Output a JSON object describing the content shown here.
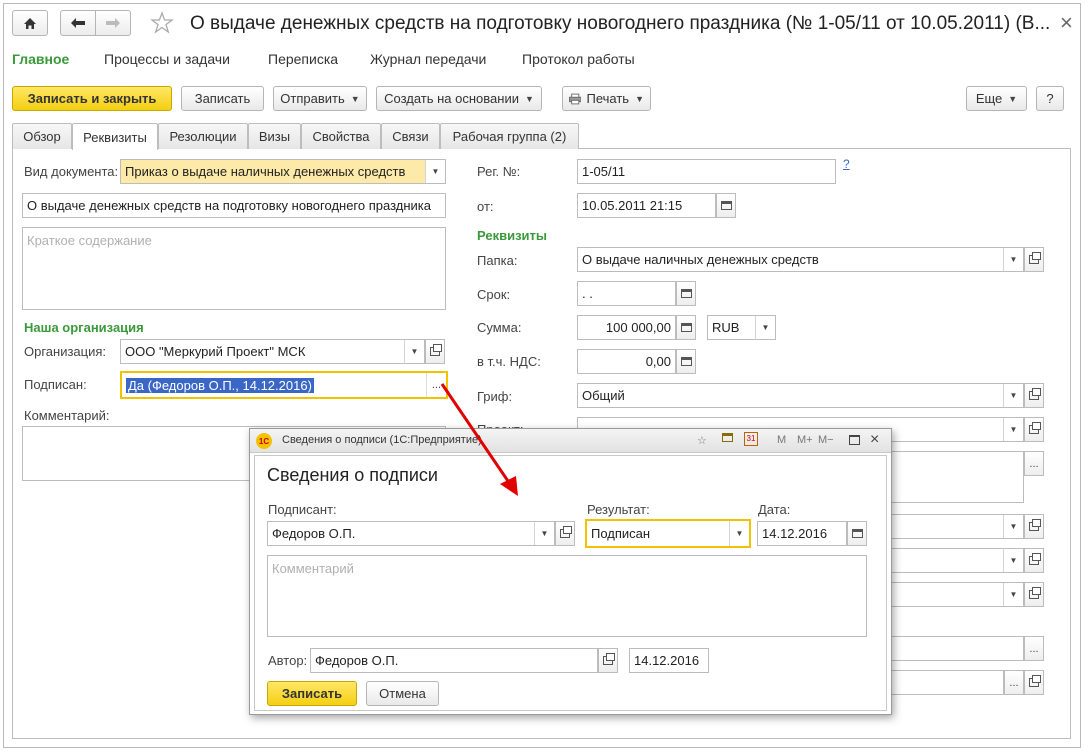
{
  "window": {
    "title": "О выдаче денежных средств на подготовку новогоднего праздника (№ 1-05/11 от 10.05.2011) (В...",
    "close_glyph": "×"
  },
  "menu": [
    "Главное",
    "Процессы и задачи",
    "Переписка",
    "Журнал передачи",
    "Протокол работы"
  ],
  "toolbar": {
    "save_close": "Записать и закрыть",
    "save": "Записать",
    "send": "Отправить",
    "create_based": "Создать на основании",
    "print": "Печать",
    "more": "Еще",
    "help": "?"
  },
  "tabs": [
    "Обзор",
    "Реквизиты",
    "Резолюции",
    "Визы",
    "Свойства",
    "Связи",
    "Рабочая группа (2)"
  ],
  "form": {
    "doc_type_label": "Вид документа:",
    "doc_type_value": "Приказ о выдаче наличных денежных средств",
    "subject_value": "О выдаче денежных средств на подготовку новогоднего праздника",
    "summary_placeholder": "Краткое содержание",
    "our_org_section": "Наша организация",
    "org_label": "Организация:",
    "org_value": "ООО \"Меркурий Проект\" МСК",
    "signed_label": "Подписан:",
    "signed_value": "Да (Федоров О.П., 14.12.2016)",
    "comment_label": "Комментарий:",
    "reg_label": "Рег. №:",
    "reg_value": "1-05/11",
    "help_link": "?",
    "from_label": "от:",
    "from_value": "10.05.2011 21:15",
    "requisites_section": "Реквизиты",
    "folder_label": "Папка:",
    "folder_value": "О выдаче наличных денежных средств",
    "deadline_label": "Срок:",
    "deadline_value": " .  .",
    "sum_label": "Сумма:",
    "sum_value": "100 000,00",
    "currency_value": "RUB",
    "vat_label": "в т.ч. НДС:",
    "vat_value": "0,00",
    "grif_label": "Гриф:",
    "grif_value": "Общий",
    "project_label": "Проект:"
  },
  "dialog": {
    "window_title": "Сведения о подписи (1С:Предприятие)",
    "heading": "Сведения о подписи",
    "signer_label": "Подписант:",
    "signer_value": "Федоров О.П.",
    "result_label": "Результат:",
    "result_value": "Подписан",
    "date_label": "Дата:",
    "date_value": "14.12.2016",
    "comment_placeholder": "Комментарий",
    "author_label": "Автор:",
    "author_value": "Федоров О.П.",
    "author_date": "14.12.2016",
    "save": "Записать",
    "cancel": "Отмена",
    "tb_m": "M",
    "tb_mplus": "M+",
    "tb_mminus": "M−",
    "calendar_day": "31"
  },
  "colors": {
    "accent_green": "#3a9a3a",
    "primary_yellow": "#f4cf12",
    "focus_yellow": "#f2c200",
    "selection_blue": "#3a66c6",
    "arrow_red": "#e00000"
  }
}
